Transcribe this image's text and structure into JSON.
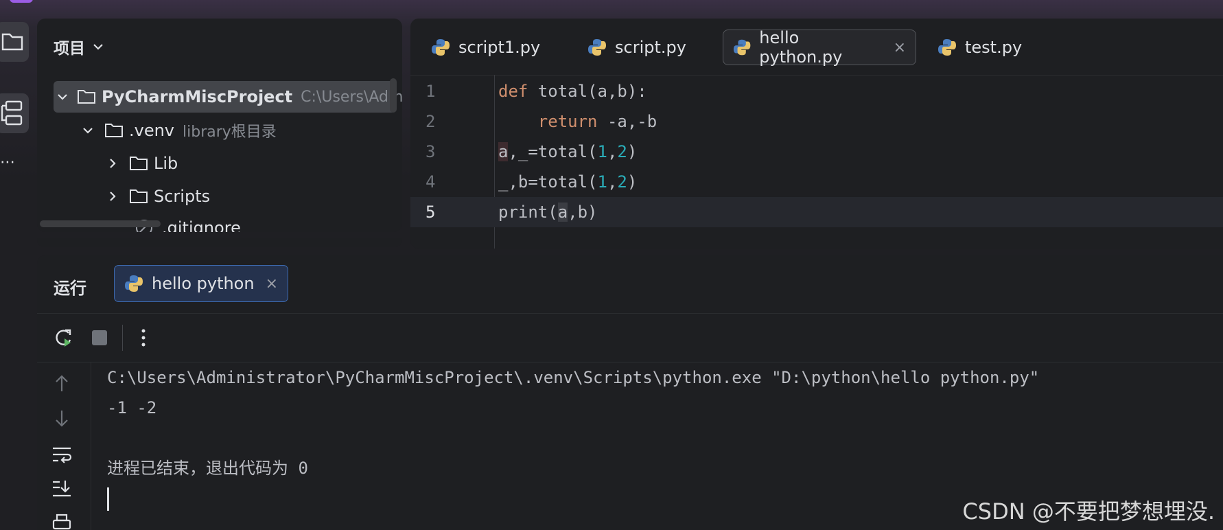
{
  "project_panel": {
    "title": "项目",
    "tree": [
      {
        "name": "PyCharmMiscProject",
        "hint": "C:\\Users\\Admi",
        "expanded": true,
        "selected": true
      },
      {
        "name": ".venv",
        "hint": "library根目录",
        "expanded": true
      },
      {
        "name": "Lib",
        "expanded": false
      },
      {
        "name": "Scripts",
        "expanded": false
      },
      {
        "name": ".gitignore"
      }
    ]
  },
  "editor": {
    "tabs": [
      {
        "label": "script1.py",
        "active": false
      },
      {
        "label": "script.py",
        "active": false
      },
      {
        "label": "hello python.py",
        "active": true,
        "close": "×"
      },
      {
        "label": "test.py",
        "active": false
      }
    ],
    "line_numbers": [
      "1",
      "2",
      "3",
      "4",
      "5"
    ],
    "current_line": 5
  },
  "run_panel": {
    "title": "运行",
    "tab_label": "hello python",
    "tab_close": "×",
    "output": [
      "C:\\Users\\Administrator\\PyCharmMiscProject\\.venv\\Scripts\\python.exe \"D:\\python\\hello python.py\"",
      "-1 -2",
      "",
      "进程已结束，退出代码为 0"
    ]
  },
  "watermark": "CSDN @不要把梦想埋没.",
  "colors": {
    "keyword": "#cf8e6d",
    "number": "#2aacb8",
    "text": "#bcbec4",
    "panel_bg": "#1e1f22",
    "accent_tab": "#3d6bb3"
  }
}
